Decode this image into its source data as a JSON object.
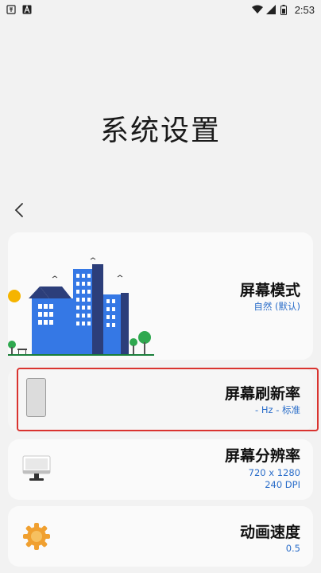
{
  "status_bar": {
    "time": "2:53",
    "left_icons": [
      "sim-icon",
      "a-icon"
    ],
    "right_icons": [
      "wifi-icon",
      "signal-icon",
      "battery-icon"
    ]
  },
  "page": {
    "title": "系统设置"
  },
  "cards": {
    "screen_mode": {
      "title": "屏幕模式",
      "subtitle": "自然 (默认)"
    },
    "refresh_rate": {
      "title": "屏幕刷新率",
      "subtitle": "- Hz - 标准"
    },
    "resolution": {
      "title": "屏幕分辨率",
      "line1": "720 x 1280",
      "line2": "240 DPI"
    },
    "animation": {
      "title": "动画速度",
      "subtitle": "0.5"
    }
  },
  "colors": {
    "accent": "#2a6dc9",
    "highlight": "#d9332f",
    "background": "#f2f2f2"
  }
}
